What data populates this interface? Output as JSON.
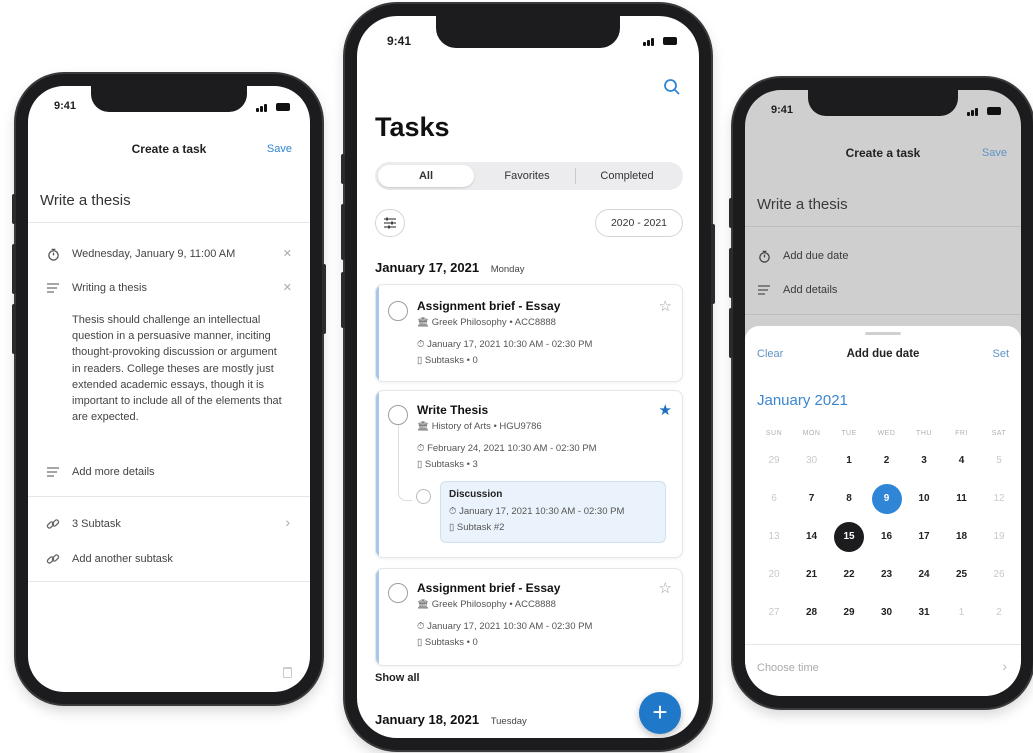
{
  "phone_left": {
    "status_time": "9:41",
    "header_title": "Create a task",
    "save_label": "Save",
    "task_title": "Write a thesis",
    "due_date": "Wednesday, January 9, 11:00 AM",
    "details_title": "Writing a thesis",
    "details_body": "Thesis should challenge an intellectual question in a persuasive manner, inciting thought-provoking discussion or argument in readers. College theses are mostly just extended academic essays, though it is important to include all of the elements that are expected.",
    "add_details": "Add  more details",
    "subtasks": "3 Subtask",
    "add_subtask": "Add another subtask"
  },
  "phone_middle": {
    "status_time": "9:41",
    "title": "Tasks",
    "tabs": [
      "All",
      "Favorites",
      "Completed"
    ],
    "year_range": "2020 - 2021",
    "groups": [
      {
        "date": "January 17, 2021",
        "weekday": "Monday"
      },
      {
        "date": "January 18, 2021",
        "weekday": "Tuesday"
      }
    ],
    "cards": [
      {
        "title": "Assignment brief - Essay",
        "course": "Greek Philosophy • ACC8888",
        "time": "January 17, 2021 10:30 AM - 02:30 PM",
        "subtasks": "Subtasks • 0"
      },
      {
        "title": "Write Thesis",
        "course": "History of Arts • HGU9786",
        "time": "February 24, 2021 10:30 AM - 02:30 PM",
        "subtasks": "Subtasks • 3",
        "sub": {
          "title": "Discussion",
          "time": "January 17, 2021 10:30 AM - 02:30 PM",
          "label": "Subtask #2"
        }
      },
      {
        "title": "Assignment brief - Essay",
        "course": "Greek Philosophy • ACC8888",
        "time": "January 17, 2021 10:30 AM - 02:30 PM",
        "subtasks": "Subtasks • 0"
      }
    ],
    "show_all": "Show all",
    "fab": "+"
  },
  "phone_right": {
    "status_time": "9:41",
    "header_title": "Create a task",
    "save_label": "Save",
    "task_title": "Write a thesis",
    "add_due_date": "Add due date",
    "add_details": "Add details",
    "sheet": {
      "clear": "Clear",
      "title": "Add due date",
      "set": "Set",
      "month": "January 2021",
      "weekdays": [
        "SUN",
        "MON",
        "TUE",
        "WED",
        "THU",
        "FRI",
        "SAT"
      ],
      "weeks": [
        [
          "29",
          "30",
          "1",
          "2",
          "3",
          "4",
          "5"
        ],
        [
          "6",
          "7",
          "8",
          "9",
          "10",
          "11",
          "12"
        ],
        [
          "13",
          "14",
          "15",
          "16",
          "17",
          "18",
          "19"
        ],
        [
          "20",
          "21",
          "22",
          "23",
          "24",
          "25",
          "26"
        ],
        [
          "27",
          "28",
          "29",
          "30",
          "31",
          "1",
          "2"
        ]
      ],
      "selected_blue": "9",
      "selected_dark": "15",
      "choose_time": "Choose time"
    }
  },
  "colors": {
    "accent": "#2f86d6",
    "fab": "#1f78c8",
    "dark_select": "#1c1c1e"
  }
}
